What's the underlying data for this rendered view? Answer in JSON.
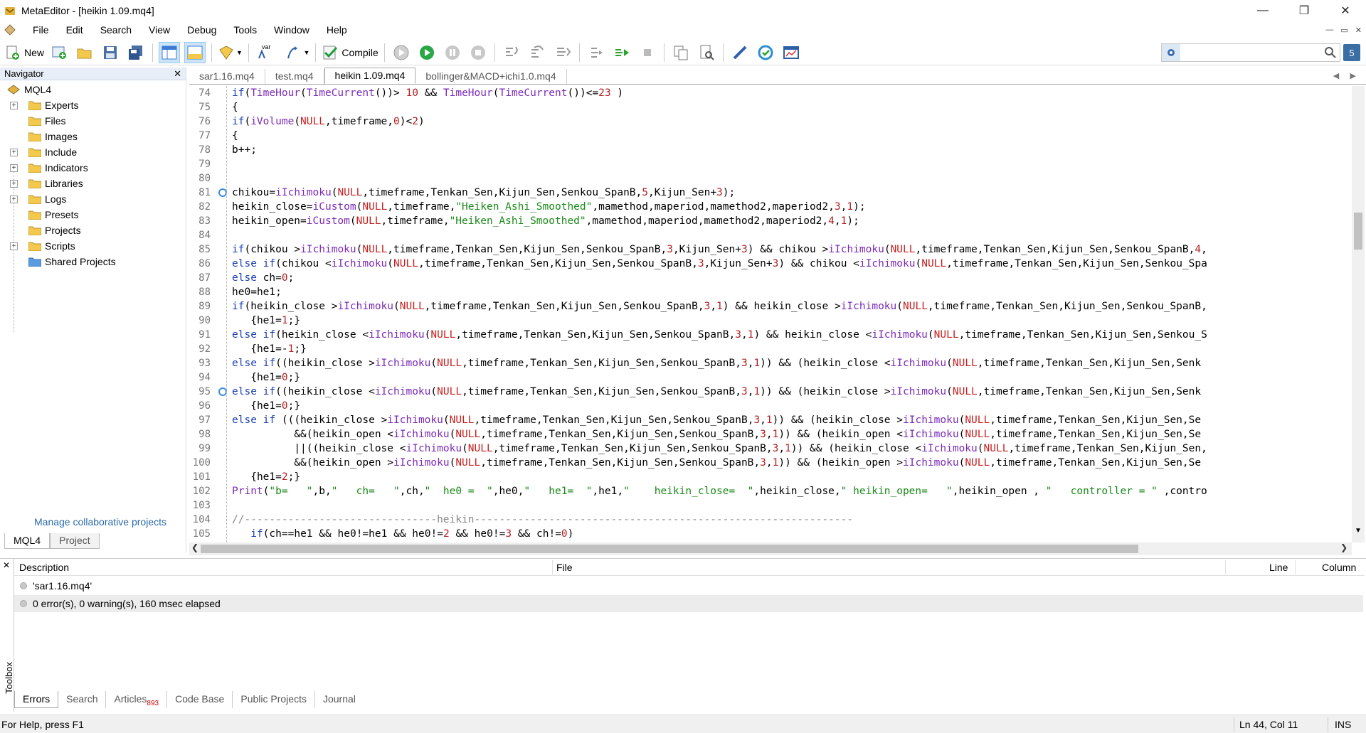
{
  "window": {
    "title": "MetaEditor - [heikin 1.09.mq4]"
  },
  "menu": [
    "File",
    "Edit",
    "Search",
    "View",
    "Debug",
    "Tools",
    "Window",
    "Help"
  ],
  "toolbar": {
    "new_label": "New",
    "compile_label": "Compile",
    "var_label": "var",
    "search_placeholder": ""
  },
  "navigator": {
    "title": "Navigator",
    "root": "MQL4",
    "items": [
      {
        "label": "Experts",
        "expandable": true
      },
      {
        "label": "Files",
        "expandable": false
      },
      {
        "label": "Images",
        "expandable": false
      },
      {
        "label": "Include",
        "expandable": true
      },
      {
        "label": "Indicators",
        "expandable": true
      },
      {
        "label": "Libraries",
        "expandable": true
      },
      {
        "label": "Logs",
        "expandable": true
      },
      {
        "label": "Presets",
        "expandable": false
      },
      {
        "label": "Projects",
        "expandable": false
      },
      {
        "label": "Scripts",
        "expandable": true
      },
      {
        "label": "Shared Projects",
        "expandable": false
      }
    ],
    "manage_link": "Manage collaborative projects",
    "tabs": [
      "MQL4",
      "Project"
    ]
  },
  "editor": {
    "tabs": [
      "sar1.16.mq4",
      "test.mq4",
      "heikin 1.09.mq4",
      "bollinger&MACD+ichi1.0.mq4"
    ],
    "active_tab": 2,
    "line_numbers": [
      "74",
      "75",
      "76",
      "77",
      "78",
      "79",
      "80",
      "81",
      "82",
      "83",
      "84",
      "85",
      "86",
      "87",
      "88",
      "89",
      "90",
      "91",
      "92",
      "93",
      "94",
      "95",
      "96",
      "97",
      "98",
      "99",
      "100",
      "101",
      "102",
      "103",
      "104",
      "105"
    ],
    "breakpoint_lines": [
      "81",
      "95"
    ],
    "code_lines": [
      "if(TimeHour(TimeCurrent())> 10 && TimeHour(TimeCurrent())<=23 )",
      "{",
      "if(iVolume(NULL,timeframe,0)<2)",
      "{",
      "b++;",
      "",
      "",
      "chikou=iIchimoku(NULL,timeframe,Tenkan_Sen,Kijun_Sen,Senkou_SpanB,5,Kijun_Sen+3);",
      "heikin_close=iCustom(NULL,timeframe,\"Heiken_Ashi_Smoothed\",mamethod,maperiod,mamethod2,maperiod2,3,1);",
      "heikin_open=iCustom(NULL,timeframe,\"Heiken_Ashi_Smoothed\",mamethod,maperiod,mamethod2,maperiod2,4,1);",
      "",
      "if(chikou >iIchimoku(NULL,timeframe,Tenkan_Sen,Kijun_Sen,Senkou_SpanB,3,Kijun_Sen+3) && chikou >iIchimoku(NULL,timeframe,Tenkan_Sen,Kijun_Sen,Senkou_SpanB,4,",
      "else if(chikou <iIchimoku(NULL,timeframe,Tenkan_Sen,Kijun_Sen,Senkou_SpanB,3,Kijun_Sen+3) && chikou <iIchimoku(NULL,timeframe,Tenkan_Sen,Kijun_Sen,Senkou_Spa",
      "else ch=0;",
      "he0=he1;",
      "if(heikin_close >iIchimoku(NULL,timeframe,Tenkan_Sen,Kijun_Sen,Senkou_SpanB,3,1) && heikin_close >iIchimoku(NULL,timeframe,Tenkan_Sen,Kijun_Sen,Senkou_SpanB,",
      "   {he1=1;}",
      "else if(heikin_close <iIchimoku(NULL,timeframe,Tenkan_Sen,Kijun_Sen,Senkou_SpanB,3,1) && heikin_close <iIchimoku(NULL,timeframe,Tenkan_Sen,Kijun_Sen,Senkou_S",
      "   {he1=-1;}",
      "else if((heikin_close >iIchimoku(NULL,timeframe,Tenkan_Sen,Kijun_Sen,Senkou_SpanB,3,1)) && (heikin_close <iIchimoku(NULL,timeframe,Tenkan_Sen,Kijun_Sen,Senk",
      "   {he1=0;}",
      "else if((heikin_close <iIchimoku(NULL,timeframe,Tenkan_Sen,Kijun_Sen,Senkou_SpanB,3,1)) && (heikin_close >iIchimoku(NULL,timeframe,Tenkan_Sen,Kijun_Sen,Senk",
      "   {he1=0;}",
      "else if (((heikin_close >iIchimoku(NULL,timeframe,Tenkan_Sen,Kijun_Sen,Senkou_SpanB,3,1)) && (heikin_close >iIchimoku(NULL,timeframe,Tenkan_Sen,Kijun_Sen,Se",
      "          &&(heikin_open <iIchimoku(NULL,timeframe,Tenkan_Sen,Kijun_Sen,Senkou_SpanB,3,1)) && (heikin_open <iIchimoku(NULL,timeframe,Tenkan_Sen,Kijun_Sen,Se",
      "          ||((heikin_close <iIchimoku(NULL,timeframe,Tenkan_Sen,Kijun_Sen,Senkou_SpanB,3,1)) && (heikin_close <iIchimoku(NULL,timeframe,Tenkan_Sen,Kijun_Sen,",
      "          &&(heikin_open >iIchimoku(NULL,timeframe,Tenkan_Sen,Kijun_Sen,Senkou_SpanB,3,1)) && (heikin_open >iIchimoku(NULL,timeframe,Tenkan_Sen,Kijun_Sen,Se",
      "   {he1=2;}",
      "Print(\"b=   \",b,\"   ch=   \",ch,\"  he0 =  \",he0,\"   he1=  \",he1,\"    heikin_close=  \",heikin_close,\" heikin_open=   \",heikin_open , \"   controller = \" ,contro",
      "",
      "//-------------------------------heikin-------------------------------------------------------------",
      "   if(ch==he1 && he0!=he1 && he0!=2 && he0!=3 && ch!=0)"
    ]
  },
  "toolbox": {
    "side_label": "Toolbox",
    "columns": {
      "description": "Description",
      "file": "File",
      "line": "Line",
      "column": "Column"
    },
    "rows": [
      "'sar1.16.mq4'",
      "0 error(s), 0 warning(s), 160 msec elapsed"
    ],
    "tabs": [
      "Errors",
      "Search",
      "Articles",
      "Code Base",
      "Public Projects",
      "Journal"
    ],
    "articles_badge": "893"
  },
  "statusbar": {
    "help": "For Help, press F1",
    "position": "Ln 44, Col 11",
    "mode": "INS"
  }
}
